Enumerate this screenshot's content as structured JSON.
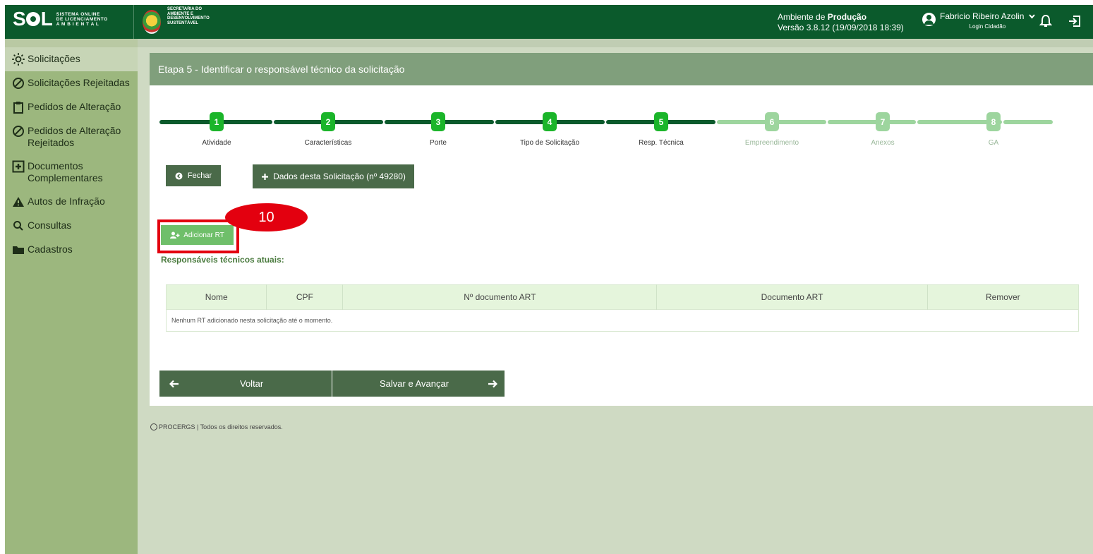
{
  "header": {
    "logo_word": "S L",
    "logo_sub": [
      "SISTEMA ONLINE",
      "DE LICENCIAMENTO",
      "A M B I E N T A L"
    ],
    "sema_lines": [
      "SECRETARIA DO",
      "AMBIENTE E",
      "DESENVOLVIMENTO",
      "SUSTENTÁVEL"
    ],
    "env_prefix": "Ambiente de ",
    "env_name": "Produção",
    "version": "Versão 3.8.12 (19/09/2018 18:39)",
    "user_name": "Fabricio Ribeiro Azolin",
    "login_type": "Login Cidadão"
  },
  "sidebar": {
    "items": [
      {
        "label": "Solicitações",
        "icon": "sun-icon"
      },
      {
        "label": "Solicitações Rejeitadas",
        "icon": "ban-icon"
      },
      {
        "label": "Pedidos de Alteração",
        "icon": "clipboard-icon"
      },
      {
        "label": "Pedidos de Alteração Rejeitados",
        "icon": "ban-icon"
      },
      {
        "label": "Documentos Complementares",
        "icon": "plus-square-icon"
      },
      {
        "label": "Autos de Infração",
        "icon": "warning-icon"
      },
      {
        "label": "Consultas",
        "icon": "search-icon"
      },
      {
        "label": "Cadastros",
        "icon": "folder-icon"
      }
    ]
  },
  "main": {
    "title": "Etapa 5 - Identificar o responsável técnico da solicitação",
    "steps": [
      {
        "num": "1",
        "label": "Atividade",
        "done": true
      },
      {
        "num": "2",
        "label": "Características",
        "done": true
      },
      {
        "num": "3",
        "label": "Porte",
        "done": true
      },
      {
        "num": "4",
        "label": "Tipo de Solicitação",
        "done": true
      },
      {
        "num": "5",
        "label": "Resp. Técnica",
        "done": true
      },
      {
        "num": "6",
        "label": "Empreendimento",
        "done": false
      },
      {
        "num": "7",
        "label": "Anexos",
        "done": false
      },
      {
        "num": "8",
        "label": "GA",
        "done": false
      }
    ],
    "close_label": "Fechar",
    "details_label": "Dados desta Solicitação (nº 49280)",
    "add_rt_label": "Adicionar RT",
    "callout_number": "10",
    "rt_title": "Responsáveis técnicos atuais:",
    "table_headers": [
      "Nome",
      "CPF",
      "Nº documento ART",
      "Documento ART",
      "Remover"
    ],
    "empty_message": "Nenhum RT adicionado nesta solicitação até o momento.",
    "back_label": "Voltar",
    "save_label": "Salvar e Avançar"
  },
  "footer": {
    "text": "PROCERGS | Todos os direitos reservados."
  },
  "colors": {
    "topbar": "#0b5a2c",
    "sidebar": "#9cb77e",
    "step_done": "#1bb52a",
    "step_todo": "#9dd59e",
    "callout": "#e3000f"
  }
}
